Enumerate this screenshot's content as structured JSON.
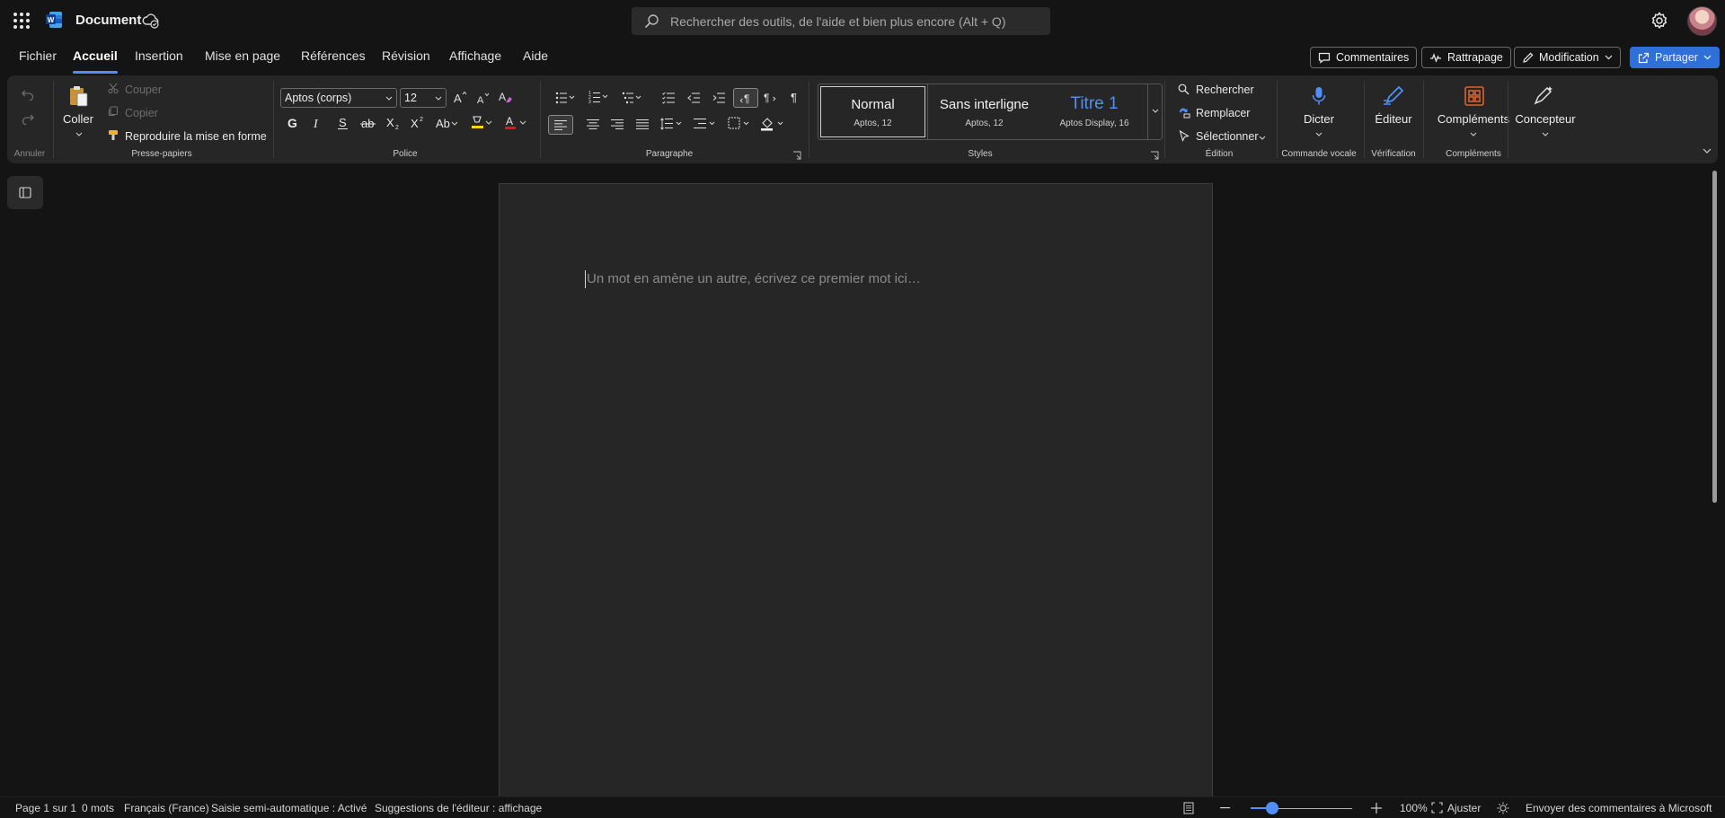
{
  "titlebar": {
    "doc_name": "Document",
    "search_placeholder": "Rechercher des outils, de l'aide et bien plus encore (Alt + Q)"
  },
  "tabs": [
    "Fichier",
    "Accueil",
    "Insertion",
    "Mise en page",
    "Références",
    "Révision",
    "Affichage",
    "Aide"
  ],
  "active_tab": "Accueil",
  "top_buttons": {
    "comments": "Commentaires",
    "catchup": "Rattrapage",
    "mode": "Modification",
    "share": "Partager"
  },
  "ribbon": {
    "undo_group": "Annuler",
    "clipboard": {
      "group": "Presse-papiers",
      "paste": "Coller",
      "cut": "Couper",
      "copy": "Copier",
      "format_painter": "Reproduire la mise en forme"
    },
    "font": {
      "group": "Police",
      "font_name": "Aptos (corps)",
      "font_size": "12",
      "font_color": "#e81123",
      "highlight_color": "#ffd700"
    },
    "paragraph": {
      "group": "Paragraphe"
    },
    "styles": {
      "group": "Styles",
      "items": [
        {
          "name": "Normal",
          "sub": "Aptos, 12"
        },
        {
          "name": "Sans interligne",
          "sub": "Aptos, 12"
        },
        {
          "name": "Titre 1",
          "sub": "Aptos Display, 16"
        }
      ],
      "title_color": "#4f8ff7"
    },
    "editing": {
      "group": "Édition",
      "find": "Rechercher",
      "replace": "Remplacer",
      "select": "Sélectionner"
    },
    "voice": {
      "group": "Commande vocale",
      "dictate": "Dicter"
    },
    "proofing": {
      "group": "Vérification",
      "editor": "Éditeur"
    },
    "addins": {
      "group": "Compléments",
      "label": "Compléments"
    },
    "designer": {
      "label": "Concepteur"
    }
  },
  "document": {
    "placeholder": "Un mot en amène un autre, écrivez ce premier mot ici…"
  },
  "status": {
    "page": "Page 1 sur 1",
    "words": "0 mots",
    "language": "Français (France)",
    "autocomplete": "Saisie semi-automatique : Activé",
    "editor_suggestions": "Suggestions de l'éditeur : affichage",
    "zoom": "100%",
    "fit": "Ajuster",
    "feedback": "Envoyer des commentaires à Microsoft"
  },
  "accent": "#4f8ff7"
}
